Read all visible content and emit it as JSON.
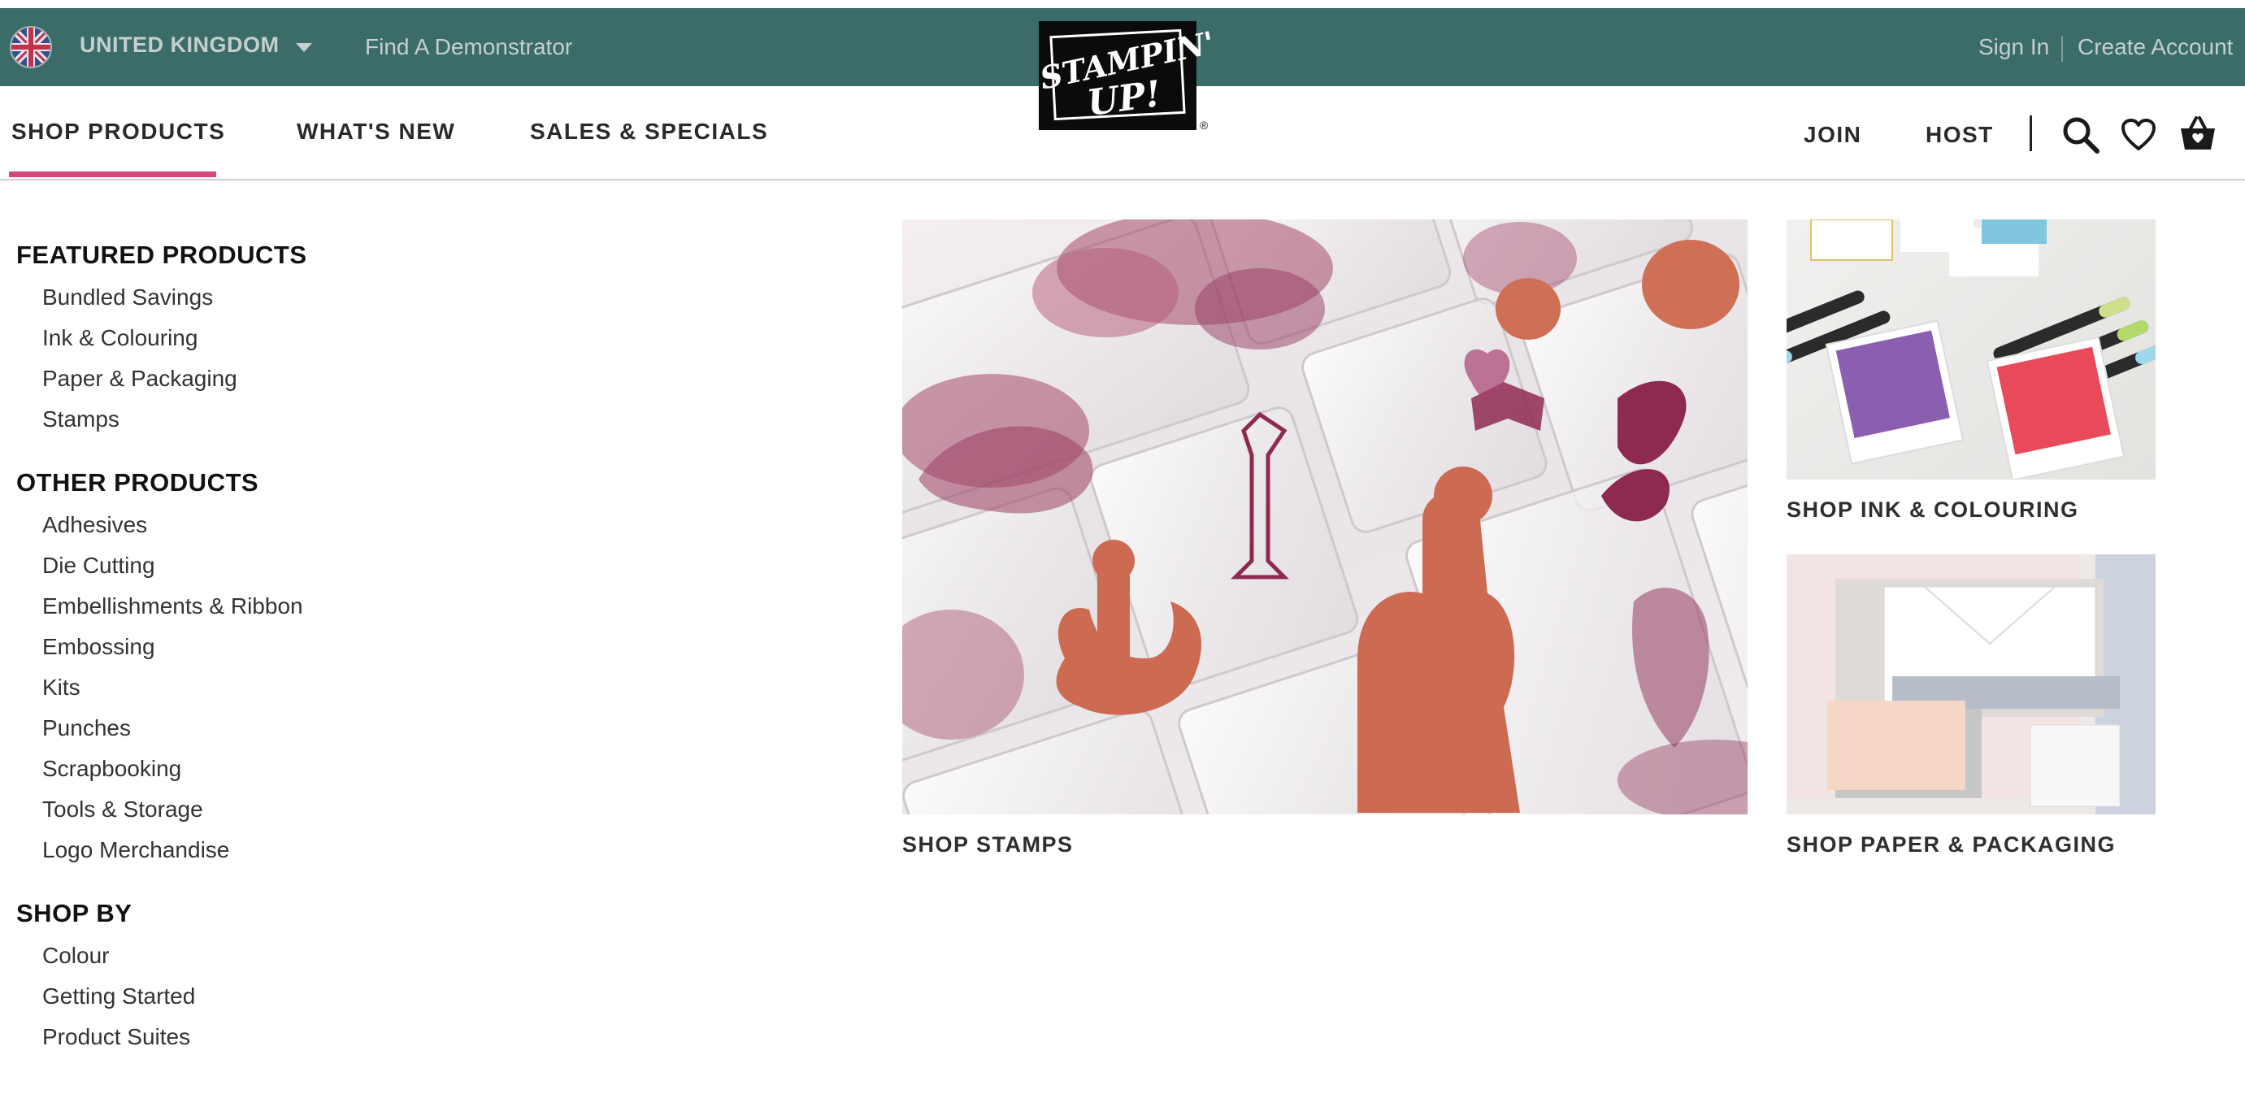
{
  "topbar": {
    "country": "UNITED KINGDOM",
    "find_demonstrator": "Find A Demonstrator",
    "sign_in": "Sign In",
    "create_account": "Create Account",
    "background_color": "#3b6c67"
  },
  "logo": {
    "line1": "STAMPIN'",
    "line2": "UP!",
    "registered": "®"
  },
  "nav": {
    "items": [
      {
        "label": "SHOP PRODUCTS",
        "active": true
      },
      {
        "label": "WHAT'S NEW"
      },
      {
        "label": "SALES & SPECIALS"
      }
    ],
    "join": "JOIN",
    "host": "HOST",
    "active_color": "#d6487b"
  },
  "menu": {
    "featured": {
      "heading": "FEATURED PRODUCTS",
      "items": [
        "Bundled Savings",
        "Ink & Colouring",
        "Paper & Packaging",
        "Stamps"
      ]
    },
    "other": {
      "heading": "OTHER PRODUCTS",
      "items": [
        "Adhesives",
        "Die Cutting",
        "Embellishments & Ribbon",
        "Embossing",
        "Kits",
        "Punches",
        "Scrapbooking",
        "Tools & Storage",
        "Logo Merchandise"
      ]
    },
    "shop_by": {
      "heading": "SHOP BY",
      "items": [
        "Colour",
        "Getting Started",
        "Product Suites"
      ]
    }
  },
  "tiles": {
    "stamps": "SHOP STAMPS",
    "ink": "SHOP INK & COLOURING",
    "paper": "SHOP PAPER & PACKAGING"
  },
  "icons": [
    "uk-flag-icon",
    "chevron-down-icon",
    "search-icon",
    "heart-icon",
    "basket-icon"
  ]
}
